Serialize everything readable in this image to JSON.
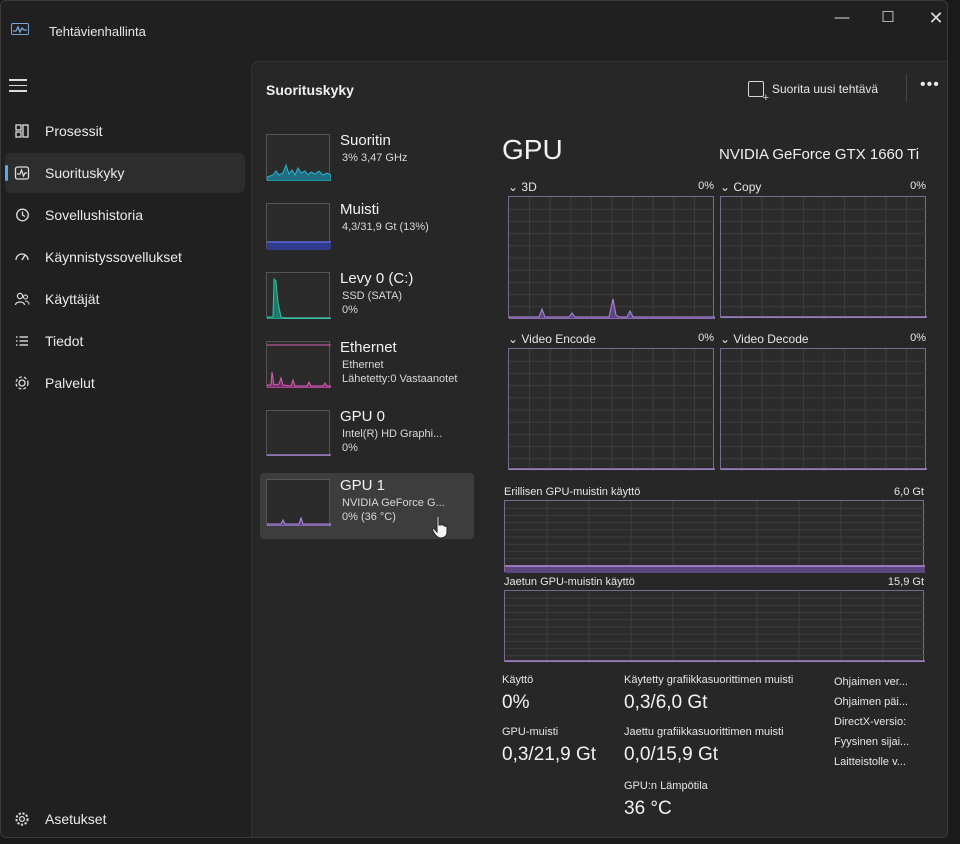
{
  "app": {
    "title": "Tehtävienhallinta",
    "controls": {
      "minimize": "—",
      "maximize": "☐",
      "close": "✕"
    }
  },
  "nav": {
    "items": [
      {
        "label": "Prosessit",
        "icon": "processes-icon",
        "active": false
      },
      {
        "label": "Suorituskyky",
        "icon": "performance-icon",
        "active": true
      },
      {
        "label": "Sovellushistoria",
        "icon": "history-icon",
        "active": false
      },
      {
        "label": "Käynnistyssovellukset",
        "icon": "startup-icon",
        "active": false
      },
      {
        "label": "Käyttäjät",
        "icon": "users-icon",
        "active": false
      },
      {
        "label": "Tiedot",
        "icon": "details-icon",
        "active": false
      },
      {
        "label": "Palvelut",
        "icon": "services-icon",
        "active": false
      }
    ],
    "settings": "Asetukset"
  },
  "header": {
    "title": "Suorituskyky",
    "run_task": "Suorita uusi tehtävä",
    "more": "•••"
  },
  "devices": [
    {
      "name": "Suoritin",
      "sub1": "3% 3,47 GHz",
      "sub2": "",
      "color": "#2ab5d6",
      "selected": false
    },
    {
      "name": "Muisti",
      "sub1": "4,3/31,9 Gt (13%)",
      "sub2": "",
      "color": "#5a6be0",
      "selected": false
    },
    {
      "name": "Levy 0 (C:)",
      "sub1": "SSD (SATA)",
      "sub2": "0%",
      "color": "#32c2a8",
      "selected": false
    },
    {
      "name": "Ethernet",
      "sub1": "Ethernet",
      "sub2": "Lähetetty:0 Vastaanotet",
      "color": "#d75fb3",
      "selected": false
    },
    {
      "name": "GPU 0",
      "sub1": "Intel(R) HD Graphi...",
      "sub2": "0%",
      "color": "#b48be0",
      "selected": false
    },
    {
      "name": "GPU 1",
      "sub1": "NVIDIA GeForce G...",
      "sub2": "0% (36 °C)",
      "color": "#b48be0",
      "selected": true
    }
  ],
  "gpu": {
    "title": "GPU",
    "model": "NVIDIA GeForce GTX 1660 Ti",
    "engines": [
      {
        "label": "3D",
        "pct": "0%"
      },
      {
        "label": "Copy",
        "pct": "0%"
      },
      {
        "label": "Video Encode",
        "pct": "0%"
      },
      {
        "label": "Video Decode",
        "pct": "0%"
      }
    ],
    "dedicated": {
      "label": "Erillisen GPU-muistin käyttö",
      "max": "6,0 Gt"
    },
    "shared": {
      "label": "Jaetun GPU-muistin käyttö",
      "max": "15,9 Gt"
    },
    "stats": {
      "usage_label": "Käyttö",
      "usage_value": "0%",
      "gpu_mem_label": "GPU-muisti",
      "gpu_mem_value": "0,3/21,9 Gt",
      "dedicated_label": "Käytetty grafiikkasuorittimen muisti",
      "dedicated_value": "0,3/6,0 Gt",
      "shared_label": "Jaettu grafiikkasuorittimen muisti",
      "shared_value": "0,0/15,9 Gt",
      "temp_label": "GPU:n Lämpötila",
      "temp_value": "36 °C"
    },
    "side_labels": [
      "Ohjaimen ver...",
      "Ohjaimen päi...",
      "DirectX-versio:",
      "Fyysinen sijai...",
      "Laitteistolle v..."
    ]
  },
  "colors": {
    "accent": "#60a8e6",
    "gpu_line": "#b48be0",
    "graph_border": "#7a6a90"
  }
}
